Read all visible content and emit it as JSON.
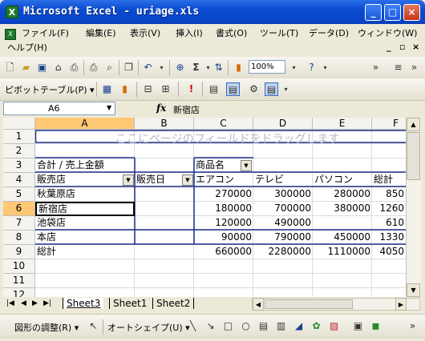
{
  "window": {
    "title": "Microsoft Excel - uriage.xls"
  },
  "titlebar_buttons": {
    "minimize": "_",
    "maximize": "□",
    "close": "×"
  },
  "menu": {
    "items": [
      "ファイル(F)",
      "編集(E)",
      "表示(V)",
      "挿入(I)",
      "書式(O)",
      "ツール(T)",
      "データ(D)",
      "ウィンドウ(W)"
    ],
    "help": "ヘルプ(H)",
    "doc_controls": [
      "_",
      "▫",
      "×"
    ]
  },
  "toolbar": {
    "zoom": "100%",
    "pivot_label": "ピボットテーブル(P) ▾"
  },
  "formula_bar": {
    "name_box": "A6",
    "fx": "fx",
    "formula": "新宿店"
  },
  "grid": {
    "columns": [
      "A",
      "B",
      "C",
      "D",
      "E",
      "F"
    ],
    "rows": [
      "1",
      "2",
      "3",
      "4",
      "5",
      "6",
      "7",
      "8",
      "9",
      "10",
      "11",
      "12"
    ],
    "page_field_hint": "ここにページのフィールドをドラッグします",
    "data_label": "合計 / 売上金額",
    "column_field": "商品名",
    "row_field_1": "販売店",
    "row_field_2": "販売日",
    "col_items": [
      "エアコン",
      "テレビ",
      "パソコン",
      "総計"
    ],
    "table": [
      {
        "store": "秋葉原店",
        "values": [
          "270000",
          "300000",
          "280000",
          "850"
        ]
      },
      {
        "store": "新宿店",
        "values": [
          "180000",
          "700000",
          "380000",
          "1260"
        ]
      },
      {
        "store": "池袋店",
        "values": [
          "120000",
          "490000",
          "",
          "610"
        ]
      },
      {
        "store": "本店",
        "values": [
          "90000",
          "790000",
          "450000",
          "1330"
        ]
      },
      {
        "store": "総計",
        "values": [
          "660000",
          "2280000",
          "1110000",
          "4050"
        ]
      }
    ]
  },
  "sheet_tabs": [
    "Sheet3",
    "Sheet1",
    "Sheet2"
  ],
  "draw_toolbar": {
    "draw_menu": "図形の調整(R) ▾",
    "autoshape": "オートシェイプ(U) ▾"
  }
}
